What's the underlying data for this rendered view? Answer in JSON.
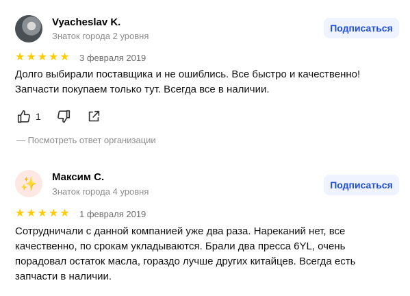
{
  "reviews": [
    {
      "author": "Vyacheslav K.",
      "level": "Знаток города 2 уровня",
      "subscribe_label": "Подписаться",
      "rating": 5,
      "date": "3 февраля 2019",
      "text": "Долго выбирали поставщика и не ошиблись. Все быстро и качественно! Запчасти покупаем только тут. Всегда все в наличии.",
      "likes": "1",
      "reply_link": "— Посмотреть ответ организации",
      "avatar_icon": "user-photo"
    },
    {
      "author": "Максим С.",
      "level": "Знаток города 4 уровня",
      "subscribe_label": "Подписаться",
      "rating": 5,
      "date": "1 февраля 2019",
      "text": "Сотрудничали с данной компанией уже два раза. Нареканий нет, все качественно, по срокам укладываются. Брали два пресса 6YL, очень порадовал остаток масла, гораздо лучше других китайцев. Всегда есть запчасти в наличии.",
      "avatar_icon": "sparkles-emoji"
    }
  ],
  "colors": {
    "star": "#ffcc00",
    "button_bg": "#eef3ff",
    "button_text": "#1f4fd6",
    "muted_text": "#8c8c8c"
  }
}
